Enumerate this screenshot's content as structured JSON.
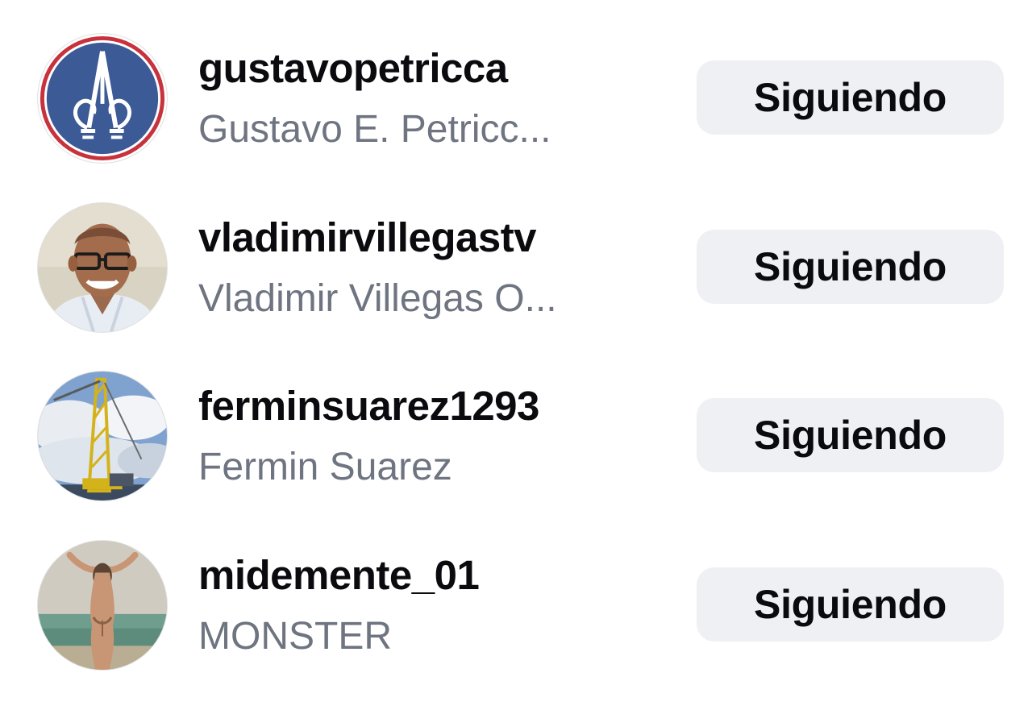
{
  "following_list": [
    {
      "username": "gustavopetricca",
      "full_name": "Gustavo E. Petricc...",
      "button_label": "Siguiendo",
      "avatar": "blue-emblem-logo"
    },
    {
      "username": "vladimirvillegastv",
      "full_name": "Vladimir Villegas O...",
      "button_label": "Siguiendo",
      "avatar": "portrait-man-glasses"
    },
    {
      "username": "ferminsuarez1293",
      "full_name": "Fermin Suarez",
      "button_label": "Siguiendo",
      "avatar": "crane-sky-photo"
    },
    {
      "username": "midemente_01",
      "full_name": "MONSTER",
      "button_label": "Siguiendo",
      "avatar": "beach-figure-photo"
    }
  ],
  "colors": {
    "username_text": "#0b0b0f",
    "fullname_text": "#6e7480",
    "button_bg": "#eff0f4",
    "emblem_blue": "#3c5a96",
    "emblem_red": "#c8323c"
  }
}
